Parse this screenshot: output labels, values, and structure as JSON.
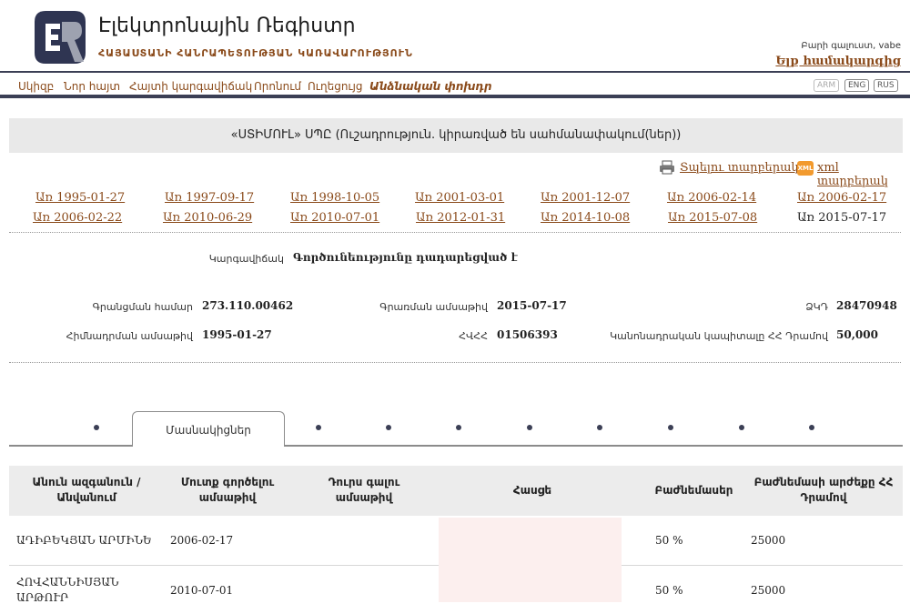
{
  "header": {
    "title": "Էլեկտրոնային Ռեգիստր",
    "subtitle": "ՀԱՅԱՍՏԱՆԻ ՀԱՆՐԱՊԵՏՈՒԹՅԱՆ ԿԱՌԱՎԱՐՈՒԹՅՈՒՆ",
    "welcome": "Բարի գալուստ, vabe",
    "login": "Ելք համակարգից",
    "logo_letters": "ER",
    "brand_color": "#2f3552",
    "accent_color": "#8a4a1a"
  },
  "nav": {
    "items": [
      "Սկիզբ",
      "Նոր հայտ",
      "Հայտի կարգավիճակ",
      "Որոնում",
      "Ուղեցույց",
      "Անձնական փոխդր"
    ],
    "active_index": 5,
    "languages": [
      "ARM",
      "ENG",
      "RUS"
    ]
  },
  "company": {
    "banner": "«ՍՏԻՄՈՒԼ» ՍՊԸ (Ուշադրություն. կիրառված են սահմանափակում(ներ))"
  },
  "print_links": {
    "print": "Տպելու տարբերակ",
    "xml": "xml տարբերակ",
    "xml_icon": "XML"
  },
  "versions": [
    "Առ 1995-01-27",
    "Առ 1997-09-17",
    "Առ 1998-10-05",
    "Առ 2001-03-01",
    "Առ 2001-12-07",
    "Առ 2006-02-14",
    "Առ 2006-02-17",
    "Առ 2006-02-22",
    "Առ 2010-06-29",
    "Առ 2010-07-01",
    "Առ 2012-01-31",
    "Առ 2014-10-08",
    "Առ 2015-07-08",
    "Առ 2015-07-17"
  ],
  "info": {
    "status_label": "Կարգավիճակ",
    "status_value": "Գործունեությունը դադարեցված է",
    "reg_number_label": "Գրանցման համար",
    "reg_number_value": "273.110.00462",
    "reg_date_label": "Գրառման ամսաթիվ",
    "reg_date_value": "2015-07-17",
    "zkd_label": "ՁԿԴ",
    "zkd_value": "28470948",
    "founding_date_label": "Հիմնադրման ամսաթիվ",
    "founding_date_value": "1995-01-27",
    "tin_label": "ՀՎՀՀ",
    "tin_value": "01506393",
    "capital_label": "Կանոնադրական կապիտալը ՀՀ Դրամով",
    "capital_value": "50,000"
  },
  "tabs": {
    "active": "Մասնակիցներ"
  },
  "table": {
    "headers": [
      "Անուն ազգանուն / Անվանում",
      "Մուտք գործելու ամսաթիվ",
      "Դուրս գալու ամսաթիվ",
      "Հասցե",
      "Բաժնեմասեր",
      "Բաժնեմասի արժեքը ՀՀ Դրամով"
    ],
    "rows": [
      {
        "name": "ԱԴԻԲԵԿՅԱՆ ԱՐՄԻՆԵ",
        "entry": "2006-02-17",
        "exit": "",
        "share": "50 %",
        "value": "25000"
      },
      {
        "name": "ՀՈՎՀԱՆՆԻՍՅԱՆ ԱՐԹՈՒՐ",
        "entry": "2010-07-01",
        "exit": "",
        "share": "50 %",
        "value": "25000"
      }
    ]
  }
}
